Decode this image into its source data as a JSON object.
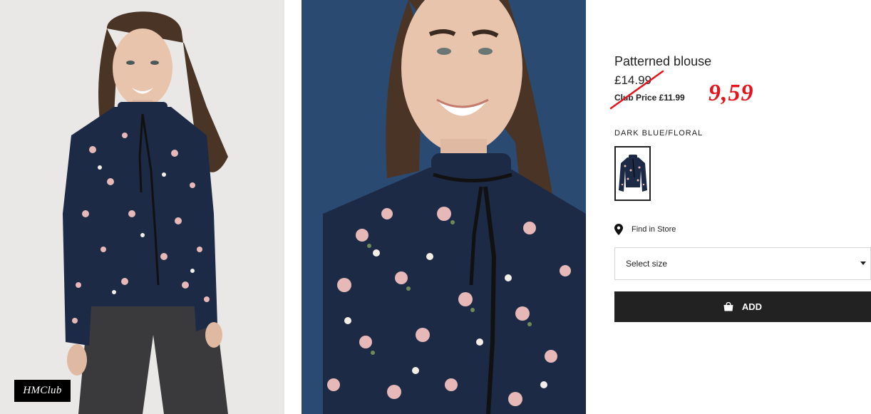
{
  "badge": {
    "label": "HMClub"
  },
  "product": {
    "title": "Patterned blouse",
    "price_original": "£14.99",
    "club_price": "Club Price £11.99",
    "handwritten_price": "9,59",
    "color_name": "DARK BLUE/FLORAL",
    "find_in_store": "Find in Store",
    "size_select_placeholder": "Select size",
    "add_button_label": "ADD"
  },
  "icons": {
    "find_in_store": "map-pin-icon",
    "add_to_bag": "shopping-bag-icon",
    "size_dropdown": "caret-down-icon"
  },
  "colors": {
    "page_background": "#ffffff",
    "text": "#222222",
    "add_button_background": "#222222",
    "annotation_red": "#e4141c",
    "blouse_navy": "#1d2a45",
    "studio_background_left": "#e9e8e6",
    "studio_background_right": "#2b4a72"
  }
}
